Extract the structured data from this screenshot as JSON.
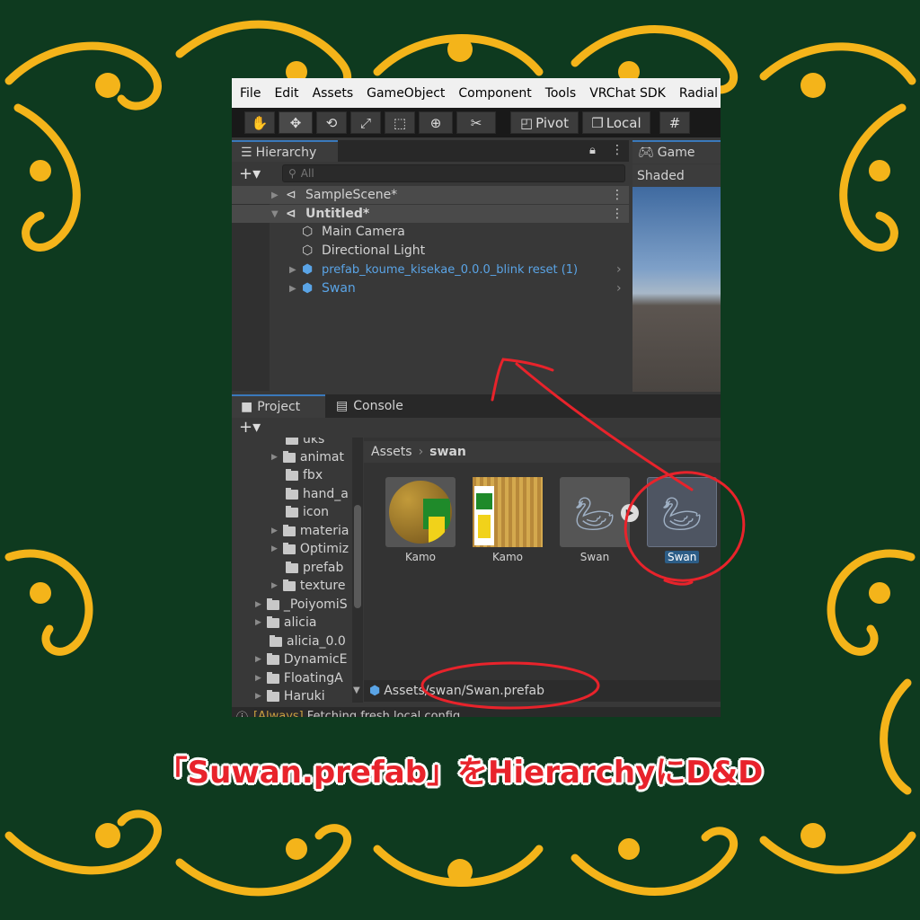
{
  "colors": {
    "background": "#0e3a1f",
    "ornament": "#f4b41a",
    "annotation": "#e8232b",
    "unity_bg": "#383838",
    "prefab_blue": "#5aa4e6"
  },
  "menubar": {
    "items": [
      "File",
      "Edit",
      "Assets",
      "GameObject",
      "Component",
      "Tools",
      "VRChat SDK",
      "Radial"
    ]
  },
  "toolbar": {
    "pivot_label": "Pivot",
    "local_label": "Local",
    "tools": [
      "hand-icon",
      "move-icon",
      "rotate-icon",
      "scale-icon",
      "rect-icon",
      "transform-icon",
      "custom-tool-icon"
    ]
  },
  "hierarchy": {
    "tab_label": "Hierarchy",
    "search_placeholder": "All",
    "rows": [
      {
        "label": "SampleScene*",
        "kind": "scene"
      },
      {
        "label": "Untitled*",
        "kind": "scene-open"
      },
      {
        "label": "Main Camera",
        "kind": "object"
      },
      {
        "label": "Directional Light",
        "kind": "object"
      },
      {
        "label": "prefab_koume_kisekae_0.0.0_blink reset (1)",
        "kind": "prefab"
      },
      {
        "label": "Swan",
        "kind": "prefab"
      }
    ]
  },
  "game": {
    "tab_label": "Game",
    "shading": "Shaded"
  },
  "project": {
    "tab_label": "Project",
    "console_tab_label": "Console",
    "folders": [
      "uks",
      "animat",
      "fbx",
      "hand_a",
      "icon",
      "materia",
      "Optimiz",
      "prefab",
      "texture",
      "_PoiyomiS",
      "alicia",
      "alicia_0.0",
      "DynamicE",
      "FloatingA",
      "Haruki"
    ],
    "breadcrumb": {
      "root": "Assets",
      "current": "swan"
    },
    "assets": [
      {
        "label": "Kamo",
        "kind": "material"
      },
      {
        "label": "Kamo",
        "kind": "texture"
      },
      {
        "label": "Swan",
        "kind": "model"
      },
      {
        "label": "Swan",
        "kind": "prefab",
        "selected": true
      }
    ],
    "selected_path": "Assets/swan/Swan.prefab"
  },
  "console": {
    "tag": "[Always]",
    "message": "Fetching fresh local config"
  },
  "caption": "「Suwan.prefab」をHierarchyにD&D"
}
